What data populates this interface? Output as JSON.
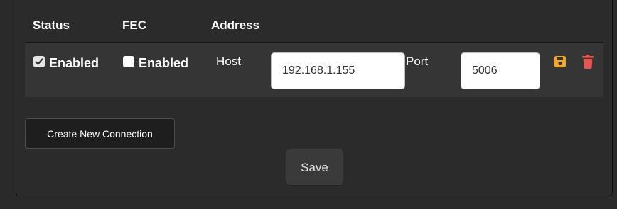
{
  "table": {
    "headers": {
      "status": "Status",
      "fec": "FEC",
      "address": "Address"
    },
    "rows": [
      {
        "status": {
          "checked": true,
          "label": "Enabled"
        },
        "fec": {
          "checked": false,
          "label": "Enabled"
        },
        "host_label": "Host",
        "host_value": "192.168.1.155",
        "port_label": "Port",
        "port_value": "5006",
        "actions": {
          "save_icon": "floppy-disk-icon",
          "delete_icon": "trash-icon"
        }
      }
    ]
  },
  "buttons": {
    "create_connection": "Create New Connection",
    "save": "Save"
  },
  "colors": {
    "save_icon": "#f5a623",
    "delete_icon": "#e8544f",
    "background": "#2a2a2a",
    "row": "#353535"
  }
}
